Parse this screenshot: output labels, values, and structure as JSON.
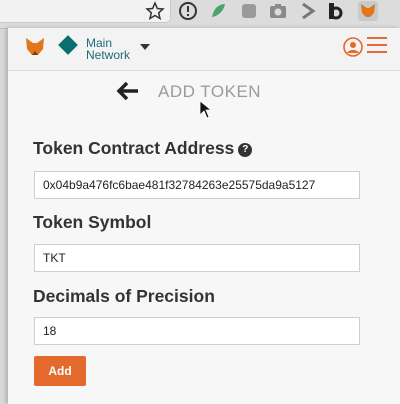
{
  "network": {
    "line1": "Main",
    "line2": "Network"
  },
  "page": {
    "title": "ADD TOKEN"
  },
  "form": {
    "contract_label": "Token Contract Address",
    "contract_value": "0x04b9a476fc6bae481f32784263e25575da9a5127",
    "symbol_label": "Token Symbol",
    "symbol_value": "TKT",
    "decimals_label": "Decimals of Precision",
    "decimals_value": "18",
    "help_glyph": "?"
  },
  "actions": {
    "add_label": "Add"
  },
  "colors": {
    "accent": "#e3692d",
    "network": "#0c6f6f",
    "title": "#9b9b9b"
  },
  "icons": [
    "star-icon",
    "info-icon",
    "extension-icon",
    "camera-icon",
    "metamask-fox-icon",
    "back-arrow-icon",
    "account-icon",
    "menu-icon"
  ]
}
